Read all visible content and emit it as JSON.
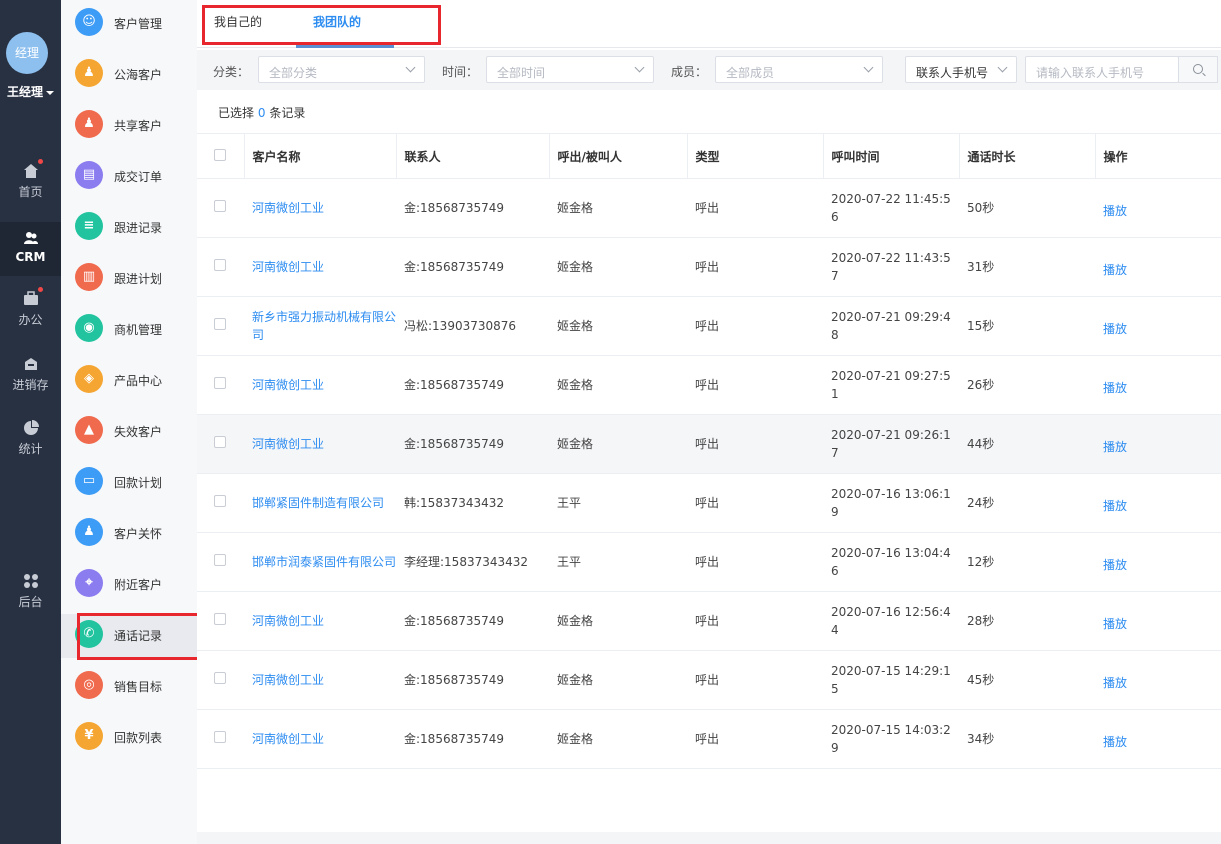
{
  "nav": {
    "avatar_text": "经理",
    "user_name": "王经理",
    "items": [
      {
        "label": "首页",
        "icon": "home-icon",
        "badge": true
      },
      {
        "label": "CRM",
        "icon": "crm-users-icon",
        "active": true
      },
      {
        "label": "办公",
        "icon": "briefcase-icon",
        "badge": true
      },
      {
        "label": "进销存",
        "icon": "warehouse-icon"
      },
      {
        "label": "统计",
        "icon": "pie-chart-icon"
      },
      {
        "label": "后台",
        "icon": "grid-apps-icon"
      }
    ]
  },
  "menu": {
    "items": [
      {
        "label": "客户管理",
        "icon": "customer-icon",
        "color": "#3d9cf5"
      },
      {
        "label": "公海客户",
        "icon": "person-icon",
        "color": "#f5a632"
      },
      {
        "label": "共享客户",
        "icon": "share-user-icon",
        "color": "#f06a4e"
      },
      {
        "label": "成交订单",
        "icon": "order-icon",
        "color": "#8b7cf0"
      },
      {
        "label": "跟进记录",
        "icon": "record-icon",
        "color": "#22c4a0"
      },
      {
        "label": "跟进计划",
        "icon": "plan-icon",
        "color": "#f06a4e"
      },
      {
        "label": "商机管理",
        "icon": "bulb-icon",
        "color": "#22c4a0"
      },
      {
        "label": "产品中心",
        "icon": "box-icon",
        "color": "#f5a632"
      },
      {
        "label": "失效客户",
        "icon": "warning-icon",
        "color": "#f06a4e"
      },
      {
        "label": "回款计划",
        "icon": "card-icon",
        "color": "#3d9cf5"
      },
      {
        "label": "客户关怀",
        "icon": "care-icon",
        "color": "#3d9cf5"
      },
      {
        "label": "附近客户",
        "icon": "location-icon",
        "color": "#8b7cf0"
      },
      {
        "label": "通话记录",
        "icon": "phone-icon",
        "color": "#22c4a0",
        "active": true
      },
      {
        "label": "销售目标",
        "icon": "target-icon",
        "color": "#f06a4e"
      },
      {
        "label": "回款列表",
        "icon": "money-icon",
        "color": "#f5a632"
      }
    ]
  },
  "tabs": [
    {
      "label": "我自己的"
    },
    {
      "label": "我团队的",
      "active": true
    }
  ],
  "filters": {
    "category_label": "分类：",
    "category_placeholder": "全部分类",
    "time_label": "时间：",
    "time_placeholder": "全部时间",
    "member_label": "成员：",
    "member_placeholder": "全部成员",
    "contact_type_value": "联系人手机号",
    "search_placeholder": "请输入联系人手机号"
  },
  "selection": {
    "prefix": "已选择",
    "count": "0",
    "suffix": "条记录"
  },
  "table": {
    "columns": [
      "客户名称",
      "联系人",
      "呼出/被叫人",
      "类型",
      "呼叫时间",
      "通话时长",
      "操作"
    ],
    "rows": [
      {
        "customer": "河南微创工业",
        "contact": "金:18568735749",
        "caller": "姬金格",
        "type": "呼出",
        "time": "2020-07-22 11:45:56",
        "duration": "50秒",
        "action": "播放"
      },
      {
        "customer": "河南微创工业",
        "contact": "金:18568735749",
        "caller": "姬金格",
        "type": "呼出",
        "time": "2020-07-22 11:43:57",
        "duration": "31秒",
        "action": "播放"
      },
      {
        "customer": "新乡市强力振动机械有限公司",
        "contact": "冯松:13903730876",
        "caller": "姬金格",
        "type": "呼出",
        "time": "2020-07-21 09:29:48",
        "duration": "15秒",
        "action": "播放"
      },
      {
        "customer": "河南微创工业",
        "contact": "金:18568735749",
        "caller": "姬金格",
        "type": "呼出",
        "time": "2020-07-21 09:27:51",
        "duration": "26秒",
        "action": "播放"
      },
      {
        "customer": "河南微创工业",
        "contact": "金:18568735749",
        "caller": "姬金格",
        "type": "呼出",
        "time": "2020-07-21 09:26:17",
        "duration": "44秒",
        "action": "播放"
      },
      {
        "customer": "邯郸紧固件制造有限公司",
        "contact": "韩:15837343432",
        "caller": "王平",
        "type": "呼出",
        "time": "2020-07-16 13:06:19",
        "duration": "24秒",
        "action": "播放"
      },
      {
        "customer": "邯郸市润泰紧固件有限公司",
        "contact": "李经理:15837343432",
        "caller": "王平",
        "type": "呼出",
        "time": "2020-07-16 13:04:46",
        "duration": "12秒",
        "action": "播放"
      },
      {
        "customer": "河南微创工业",
        "contact": "金:18568735749",
        "caller": "姬金格",
        "type": "呼出",
        "time": "2020-07-16 12:56:44",
        "duration": "28秒",
        "action": "播放"
      },
      {
        "customer": "河南微创工业",
        "contact": "金:18568735749",
        "caller": "姬金格",
        "type": "呼出",
        "time": "2020-07-15 14:29:15",
        "duration": "45秒",
        "action": "播放"
      },
      {
        "customer": "河南微创工业",
        "contact": "金:18568735749",
        "caller": "姬金格",
        "type": "呼出",
        "time": "2020-07-15 14:03:29",
        "duration": "34秒",
        "action": "播放"
      }
    ]
  },
  "colors": {
    "accent": "#2d8cf0",
    "nav_bg": "#283142",
    "highlight_box": "#e8262e"
  }
}
